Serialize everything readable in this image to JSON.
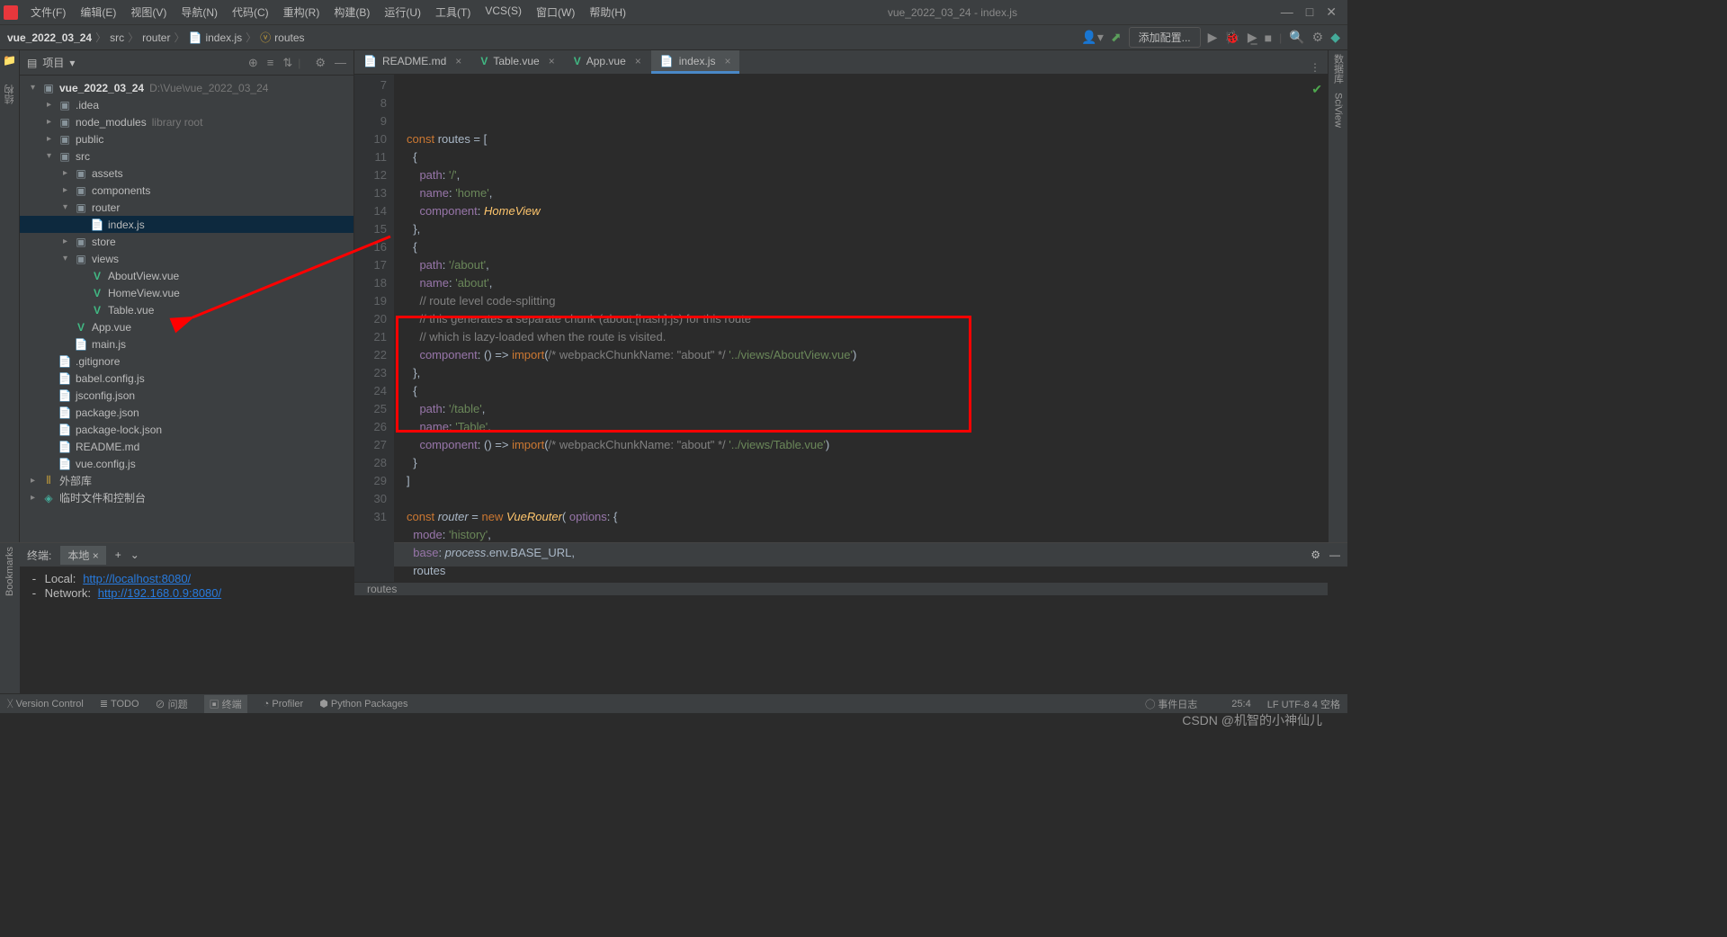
{
  "title": "vue_2022_03_24 - index.js",
  "menu": [
    "文件(F)",
    "编辑(E)",
    "视图(V)",
    "导航(N)",
    "代码(C)",
    "重构(R)",
    "构建(B)",
    "运行(U)",
    "工具(T)",
    "VCS(S)",
    "窗口(W)",
    "帮助(H)"
  ],
  "crumbs": {
    "root": "vue_2022_03_24",
    "items": [
      "src",
      "router",
      "index.js",
      "routes"
    ]
  },
  "config_label": "添加配置...",
  "project_label": "项目",
  "tree": {
    "root": {
      "name": "vue_2022_03_24",
      "path": "D:\\Vue\\vue_2022_03_24"
    },
    "idea": ".idea",
    "node_modules": "node_modules",
    "node_modules_hint": "library root",
    "public": "public",
    "src": "src",
    "assets": "assets",
    "components": "components",
    "router": "router",
    "indexjs": "index.js",
    "store": "store",
    "views": "views",
    "aboutview": "AboutView.vue",
    "homeview": "HomeView.vue",
    "tablevue": "Table.vue",
    "appvue": "App.vue",
    "mainjs": "main.js",
    "gitignore": ".gitignore",
    "babel": "babel.config.js",
    "jsconfig": "jsconfig.json",
    "package": "package.json",
    "packagelock": "package-lock.json",
    "readme": "README.md",
    "vueconfig": "vue.config.js",
    "extlib": "外部库",
    "scratch": "临时文件和控制台"
  },
  "tabs": [
    {
      "name": "README.md",
      "icon": "md"
    },
    {
      "name": "Table.vue",
      "icon": "vue"
    },
    {
      "name": "App.vue",
      "icon": "vue"
    },
    {
      "name": "index.js",
      "icon": "js",
      "active": true
    }
  ],
  "gutter_start": 7,
  "gutter_end": 31,
  "code_lines": [
    "const routes = [",
    "  {",
    "    path: '/',",
    "    name: 'home',",
    "    component: HomeView",
    "  },",
    "  {",
    "    path: '/about',",
    "    name: 'about',",
    "    // route level code-splitting",
    "    // this generates a separate chunk (about.[hash].js) for this route",
    "    // which is lazy-loaded when the route is visited.",
    "    component: () => import(/* webpackChunkName: \"about\" */ '../views/AboutView.vue')",
    "  },",
    "  {",
    "    path: '/table',",
    "    name: 'Table',",
    "    component: () => import(/* webpackChunkName: \"about\" */ '../views/Table.vue')",
    "  }",
    "]",
    "",
    "const router = new VueRouter( options: {",
    "  mode: 'history',",
    "  base: process.env.BASE_URL,",
    "  routes"
  ],
  "breadcrumb_inner": "routes",
  "terminal": {
    "label": "终端:",
    "tab": "本地",
    "local": "Local:",
    "local_url": "http://localhost:8080/",
    "network": "Network:",
    "network_url": "http://192.168.0.9:8080/"
  },
  "status": {
    "vc": "Version Control",
    "todo": "TODO",
    "problems": "问题",
    "terminal": "终端",
    "profiler": "Profiler",
    "python": "Python Packages",
    "events": "事件日志",
    "pos": "25:4",
    "enc": "LF  UTF-8  4 空格"
  },
  "watermark": "CSDN @机智的小神仙儿",
  "rightrail": [
    "数据库",
    "SciView"
  ],
  "leftrail": [
    "项目",
    "结构"
  ],
  "bookmarks": "Bookmarks"
}
